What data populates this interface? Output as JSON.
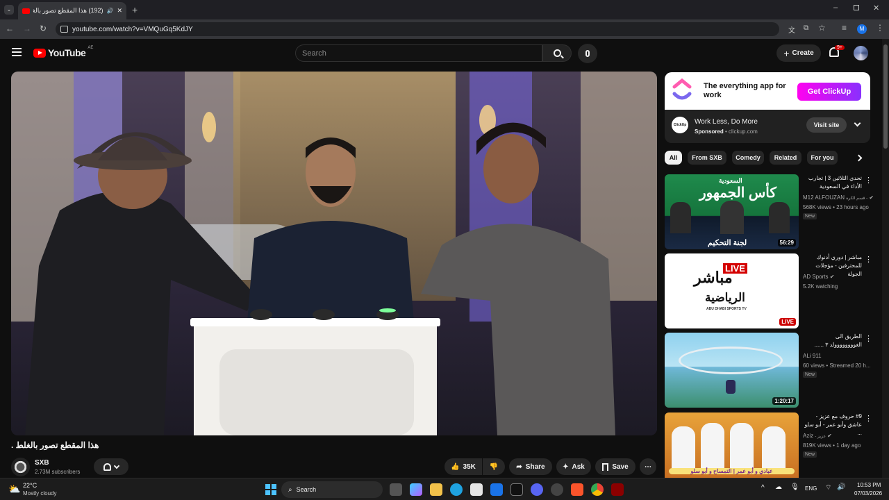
{
  "browser": {
    "tab_title": "(192) هذا المقطع تصور بالغلط",
    "new_tab": "+",
    "url": "youtube.com/watch?v=VMQuGq5KdJY",
    "profile_initial": "M"
  },
  "youtube": {
    "logo_text": "YouTube",
    "region": "AE",
    "search_placeholder": "Search",
    "create_label": "Create",
    "notifications_count": "9+"
  },
  "ad": {
    "banner_headline": "The everything app for work",
    "banner_cta": "Get ClickUp",
    "logo_text": "ClickUp",
    "title": "Work Less, Do More",
    "sponsored": "Sponsored",
    "domain": "clickup.com",
    "visit_label": "Visit site"
  },
  "chips": [
    "All",
    "From SXB",
    "Comedy",
    "Related",
    "For you"
  ],
  "recommendations": [
    {
      "title": "تحدي الثلاثين 3 | تجارب الأداء في السعودية",
      "channel": "M12 ALFOUZAN",
      "channel_suffix": "قسم الكرة -",
      "meta": "568K views • 23 hours ago",
      "badge": "New",
      "duration": "56:29",
      "thumb_text_top": "السعودية",
      "thumb_text_main": "كأس الجمهور",
      "thumb_text_bottom": "لجنة التحكيم"
    },
    {
      "title": "مباشر | دوري أدنوك للمحترفين - مؤجلات الجولة",
      "channel": "AD Sports",
      "meta": "5.2K watching",
      "badge": "",
      "duration": "LIVE",
      "thumb_text_top": "LIVE",
      "thumb_text_main": "مباشر",
      "thumb_text_sub": "الرياضية",
      "thumb_text_small": "ABU DHABI SPORTS TV"
    },
    {
      "title": "الطريق الى الغوووووووولد ٣ ......",
      "channel": "ALi 911",
      "meta": "60 views • Streamed 20 h...",
      "badge": "New",
      "duration": "1:20:17"
    },
    {
      "title": "#9 حروف مع عزيز - عاشق وأبو عمر - أبو سلو ...",
      "channel": "Aziz",
      "channel_suffix": "- عزيز",
      "meta": "819K views • 1 day ago",
      "badge": "New",
      "duration": "",
      "thumb_text_bottom": "عبادي و أبو عمر | التمساح و أبو سلو"
    }
  ],
  "video": {
    "title": "هذا المقطع تصور بالغلط .",
    "channel": "SXB",
    "subscribers": "2.73M subscribers",
    "likes": "35K",
    "share_label": "Share",
    "ask_label": "Ask",
    "save_label": "Save"
  },
  "taskbar": {
    "weather_temp": "22°C",
    "weather_desc": "Mostly cloudy",
    "search_label": "Search",
    "language": "ENG",
    "time": "10:53 PM",
    "date": "07/03/2026"
  }
}
